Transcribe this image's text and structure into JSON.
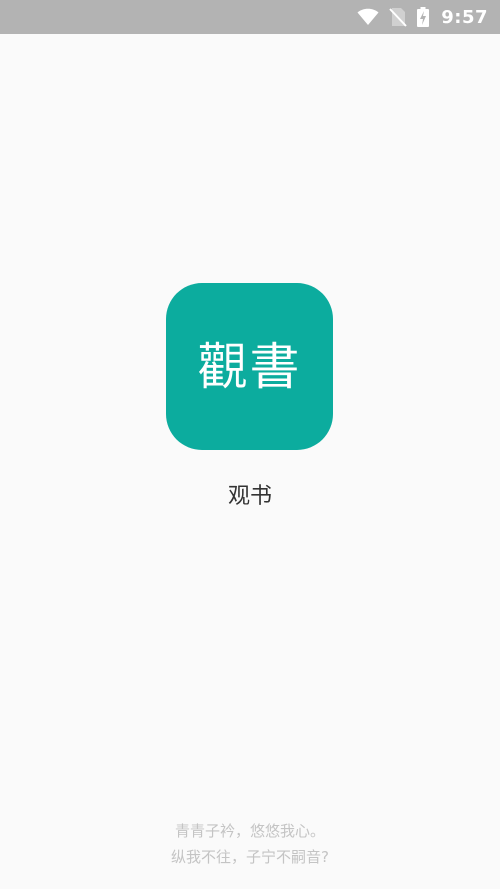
{
  "status_bar": {
    "time": "9:57",
    "icons": [
      "wifi-icon",
      "no-sim-icon",
      "battery-charging-icon"
    ]
  },
  "app": {
    "icon_text": "觀書",
    "name": "观书",
    "icon_color": "#0cac9e"
  },
  "poem": {
    "line1": "青青子衿，悠悠我心。",
    "line2": "纵我不往，子宁不嗣音?"
  }
}
